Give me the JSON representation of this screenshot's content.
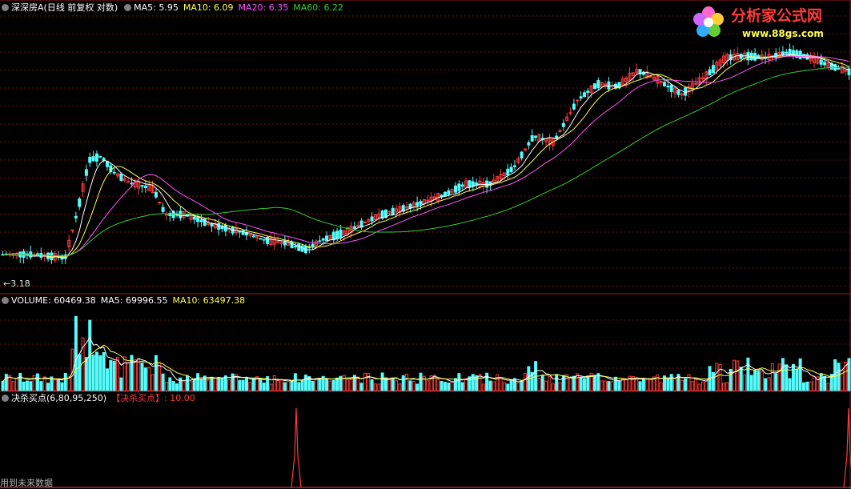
{
  "main_panel": {
    "title": "深深房A",
    "subtitle": "(日线 前复权 对数)",
    "ma5": "MA5: 5.95",
    "ma10": "MA10: 6.09",
    "ma20": "MA20: 6.35",
    "ma60": "MA60: 6.22",
    "low_marker": "←3.18"
  },
  "volume_panel": {
    "title": "VOLUME: 60469.38",
    "ma5": "MA5: 69996.55",
    "ma10": "MA10: 63497.38"
  },
  "indicator_panel": {
    "title": "决杀买点(6,80,95,250)",
    "signal": "【决杀买点】: 10.00",
    "note": "用到未来数据"
  },
  "logo": {
    "name": "分析家公式网",
    "url": "www.88gs.com"
  },
  "colors": {
    "up": "#ff3b3b",
    "down": "#54fcfc",
    "ma5": "#ffffff",
    "ma10": "#ffff55",
    "ma20": "#ff55ff",
    "ma60": "#33cc33",
    "grid": "#7a1010",
    "signal": "#ff3b3b"
  },
  "chart_data": {
    "type": "candlestick",
    "title": "深深房A",
    "price_low_label": "3.18",
    "indicator_signals": [
      {
        "position": "mid",
        "value": 10.0
      },
      {
        "position": "end",
        "value": 10.0
      }
    ]
  }
}
